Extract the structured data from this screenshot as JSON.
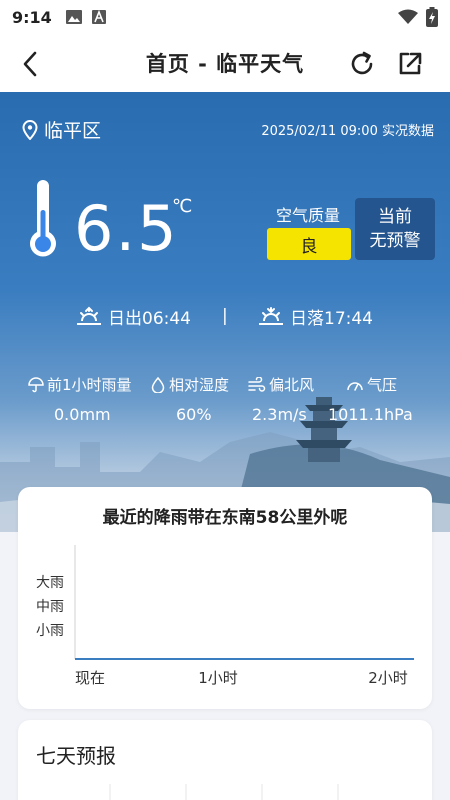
{
  "status_bar": {
    "time": "9:14"
  },
  "header": {
    "title": "首页 - 临平天气"
  },
  "current": {
    "location": "临平区",
    "observation": "2025/02/11 09:00 实况数据",
    "temperature": "6.5",
    "unit": "℃",
    "aqi_label": "空气质量",
    "aqi_value": "良",
    "aqi_color": "#f5e400",
    "warning_line1": "当前",
    "warning_line2": "无预警",
    "sunrise": "日出06:44",
    "sunset": "日落17:44",
    "divider": "|"
  },
  "metrics": [
    {
      "icon": "umbrella-icon",
      "label": "前1小时雨量",
      "value": "0.0mm"
    },
    {
      "icon": "droplet-icon",
      "label": "相对湿度",
      "value": "60%"
    },
    {
      "icon": "wind-icon",
      "label": "偏北风",
      "value": "2.3m/s"
    },
    {
      "icon": "gauge-icon",
      "label": "气压",
      "value": "1011.1hPa"
    }
  ],
  "rain_card": {
    "title": "最近的降雨带在东南58公里外呢",
    "y_labels": [
      "大雨",
      "中雨",
      "小雨"
    ],
    "x_labels": [
      "现在",
      "1小时",
      "2小时"
    ]
  },
  "chart_data": {
    "type": "line",
    "title": "最近的降雨带在东南58公里外呢",
    "x": [
      "现在",
      "1小时",
      "2小时"
    ],
    "y_categories": [
      "小雨",
      "中雨",
      "大雨"
    ],
    "series": [
      {
        "values": [
          0,
          0,
          0
        ]
      }
    ],
    "line_color": "#3a7dc0"
  },
  "forecast": {
    "title": "七天预报"
  }
}
